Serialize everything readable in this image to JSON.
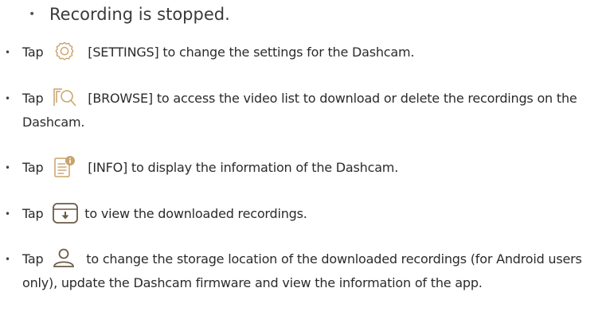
{
  "sub_bullet": "Recording is stopped.",
  "items": [
    {
      "tap": "Tap",
      "icon": "gear-icon",
      "text": "[SETTINGS] to change the settings for the Dashcam."
    },
    {
      "tap": "Tap",
      "icon": "browse-search-icon",
      "text": "[BROWSE] to access the video list to download or delete the recordings on the Dashcam."
    },
    {
      "tap": "Tap",
      "icon": "info-document-icon",
      "text": "[INFO] to display the information of the Dashcam."
    },
    {
      "tap": "Tap",
      "icon": "download-tray-icon",
      "text": "to view the downloaded recordings."
    },
    {
      "tap": "Tap",
      "icon": "user-icon",
      "text": "to change the storage location of the downloaded recordings (for Android users only), update the Dashcam firmware and view the information of the app."
    }
  ],
  "colors": {
    "icon_gold": "#c9a36a",
    "icon_dark": "#6b5b45",
    "text": "#2b2b2b"
  }
}
